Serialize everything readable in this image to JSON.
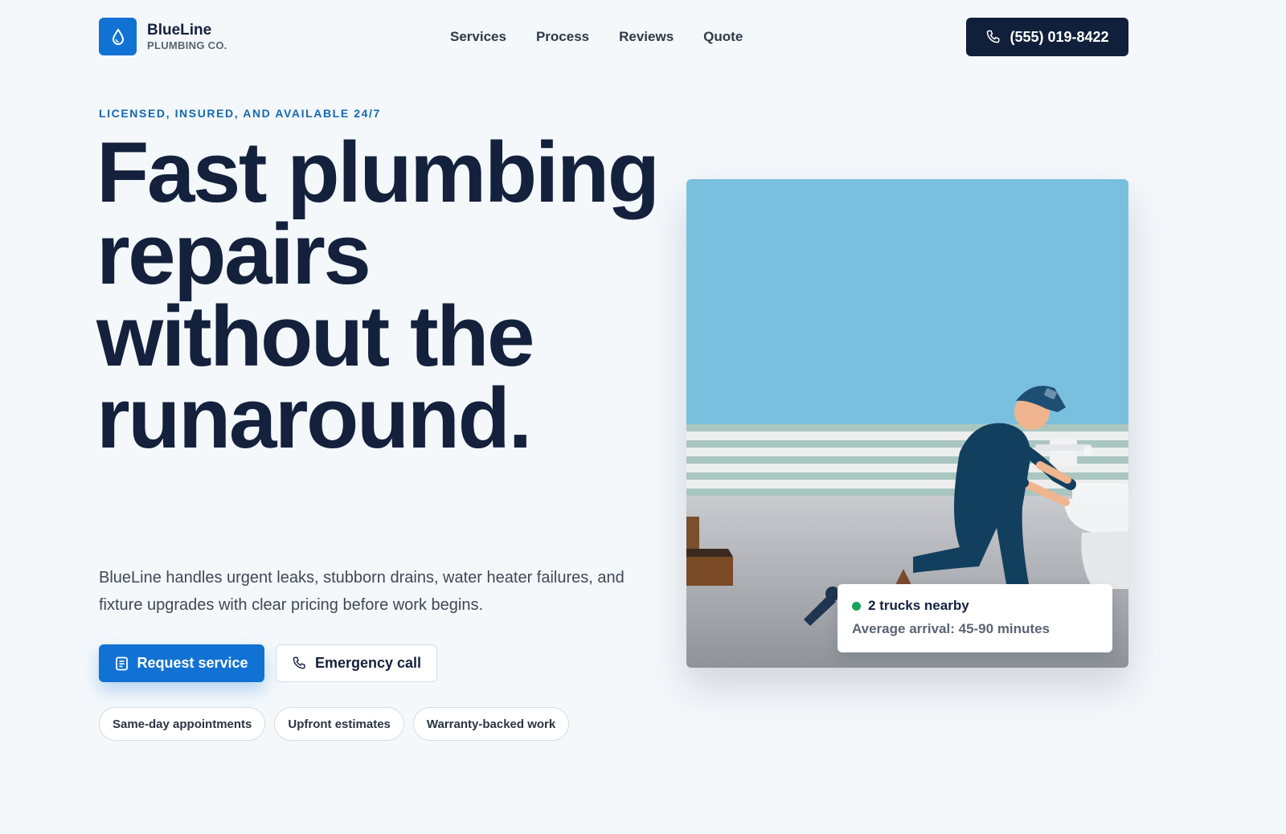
{
  "brand": {
    "name": "BlueLine",
    "subtitle": "PLUMBING CO.",
    "accent_color": "#1272d3",
    "dark_color": "#10203a",
    "icon": "water-drop-icon"
  },
  "nav": {
    "items": [
      {
        "label": "Services"
      },
      {
        "label": "Process"
      },
      {
        "label": "Reviews"
      },
      {
        "label": "Quote"
      }
    ]
  },
  "header": {
    "phone_label": "(555) 019-8422",
    "phone_icon": "phone-icon"
  },
  "hero": {
    "eyebrow": "LICENSED, INSURED, AND AVAILABLE 24/7",
    "headline": "Fast plumbing repairs without the runaround.",
    "lede": "BlueLine handles urgent leaks, stubborn drains, water heater failures, and fixture upgrades with clear pricing before work begins.",
    "primary_cta": {
      "label": "Request service",
      "icon": "document-icon"
    },
    "secondary_cta": {
      "label": "Emergency call",
      "icon": "phone-icon"
    },
    "chips": [
      {
        "label": "Same-day appointments"
      },
      {
        "label": "Upfront estimates"
      },
      {
        "label": "Warranty-backed work"
      }
    ]
  },
  "status": {
    "title": "2 trucks nearby",
    "subtitle": "Average arrival: 45-90 minutes",
    "dot_color": "#1aa35b"
  }
}
